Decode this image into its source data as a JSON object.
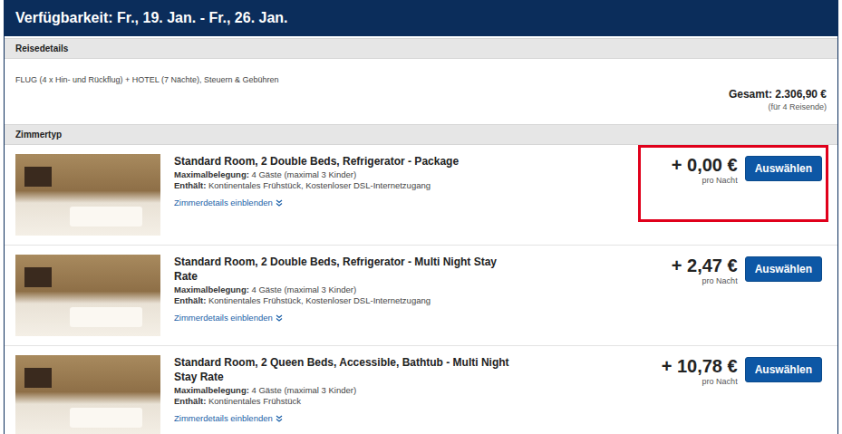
{
  "header": {
    "title": "Verfügbarkeit: Fr., 19. Jan. - Fr., 26. Jan."
  },
  "trip": {
    "section": "Reisedetails",
    "description": "FLUG (4 x Hin- und Rückflug) + HOTEL (7 Nächte), Steuern & Gebühren",
    "total": "Gesamt: 2.306,90 €",
    "travellers": "(für 4 Reisende)"
  },
  "rooms_section": "Zimmertyp",
  "rooms": [
    {
      "title": "Standard Room, 2 Double Beds, Refrigerator - Package",
      "occupancy_label": "Maximalbelegung:",
      "occupancy": "4 Gäste (maximal 3 Kinder)",
      "includes_label": "Enthält:",
      "includes": "Kontinentales Frühstück, Kostenloser DSL-Internetzugang",
      "details_link": "Zimmerdetails einblenden",
      "price": "+ 0,00 €",
      "per": "pro Nacht",
      "button": "Auswählen",
      "highlighted": true
    },
    {
      "title": "Standard Room, 2 Double Beds, Refrigerator - Multi Night Stay Rate",
      "occupancy_label": "Maximalbelegung:",
      "occupancy": "4 Gäste (maximal 3 Kinder)",
      "includes_label": "Enthält:",
      "includes": "Kontinentales Frühstück, Kostenloser DSL-Internetzugang",
      "details_link": "Zimmerdetails einblenden",
      "price": "+ 2,47 €",
      "per": "pro Nacht",
      "button": "Auswählen",
      "highlighted": false
    },
    {
      "title": "Standard Room, 2 Queen Beds, Accessible, Bathtub - Multi Night Stay Rate",
      "occupancy_label": "Maximalbelegung:",
      "occupancy": "4 Gäste (maximal 3 Kinder)",
      "includes_label": "Enthält:",
      "includes": "Kontinentales Frühstück",
      "details_link": "Zimmerdetails einblenden",
      "price": "+ 10,78 €",
      "per": "pro Nacht",
      "button": "Auswählen",
      "highlighted": false
    }
  ]
}
